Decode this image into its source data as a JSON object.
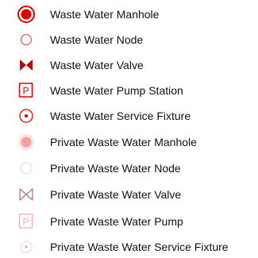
{
  "legend": {
    "items": [
      {
        "label": "Waste Water Manhole",
        "icon": "manhole-icon",
        "color": "#e00000"
      },
      {
        "label": "Waste Water Node",
        "icon": "node-icon",
        "color": "#e00000"
      },
      {
        "label": "Waste Water Valve",
        "icon": "valve-icon",
        "color": "#c40000"
      },
      {
        "label": "Waste Water Pump Station",
        "icon": "pump-station-icon",
        "color": "#e00000"
      },
      {
        "label": "Waste Water Service Fixture",
        "icon": "service-fixture-icon",
        "color": "#e00000"
      },
      {
        "label": "Private Waste Water Manhole",
        "icon": "private-manhole-icon",
        "color": "#f5a0a0"
      },
      {
        "label": "Private Waste Water Node",
        "icon": "private-node-icon",
        "color": "#f7cfcf"
      },
      {
        "label": "Private Waste Water Valve",
        "icon": "private-valve-icon",
        "color": "#c68b8b"
      },
      {
        "label": "Private Waste Water Pump",
        "icon": "private-pump-icon",
        "color": "#f3b0b0"
      },
      {
        "label": "Private Waste Water Service Fixture",
        "icon": "private-service-fixture-icon",
        "color": "#f5b5b5"
      }
    ]
  }
}
